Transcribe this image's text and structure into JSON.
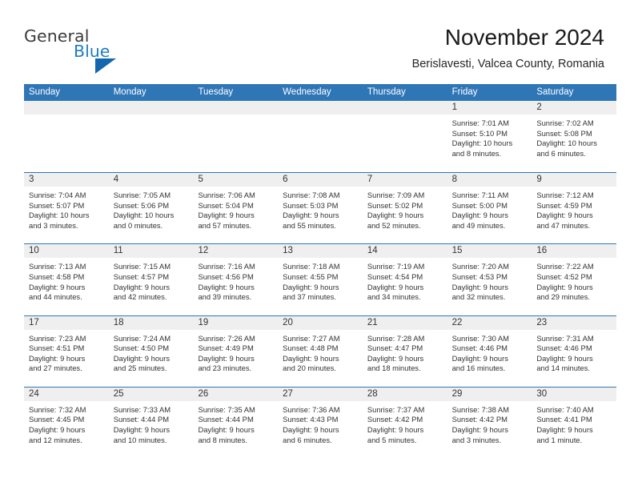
{
  "brand": {
    "name_part1": "General",
    "name_part2": "Blue",
    "triangle_icon": "triangle-logo-icon",
    "color_dark": "#3b3b3b",
    "color_blue": "#1d7dc4"
  },
  "header": {
    "title": "November 2024",
    "subtitle": "Berislavesti, Valcea County, Romania"
  },
  "theme": {
    "header_blue": "#2f76b7",
    "daynum_band": "#efefef",
    "text": "#333333"
  },
  "weekdays": [
    "Sunday",
    "Monday",
    "Tuesday",
    "Wednesday",
    "Thursday",
    "Friday",
    "Saturday"
  ],
  "weeks": [
    [
      {
        "day": "",
        "lines": []
      },
      {
        "day": "",
        "lines": []
      },
      {
        "day": "",
        "lines": []
      },
      {
        "day": "",
        "lines": []
      },
      {
        "day": "",
        "lines": []
      },
      {
        "day": "1",
        "lines": [
          "Sunrise: 7:01 AM",
          "Sunset: 5:10 PM",
          "Daylight: 10 hours",
          "and 8 minutes."
        ]
      },
      {
        "day": "2",
        "lines": [
          "Sunrise: 7:02 AM",
          "Sunset: 5:08 PM",
          "Daylight: 10 hours",
          "and 6 minutes."
        ]
      }
    ],
    [
      {
        "day": "3",
        "lines": [
          "Sunrise: 7:04 AM",
          "Sunset: 5:07 PM",
          "Daylight: 10 hours",
          "and 3 minutes."
        ]
      },
      {
        "day": "4",
        "lines": [
          "Sunrise: 7:05 AM",
          "Sunset: 5:06 PM",
          "Daylight: 10 hours",
          "and 0 minutes."
        ]
      },
      {
        "day": "5",
        "lines": [
          "Sunrise: 7:06 AM",
          "Sunset: 5:04 PM",
          "Daylight: 9 hours",
          "and 57 minutes."
        ]
      },
      {
        "day": "6",
        "lines": [
          "Sunrise: 7:08 AM",
          "Sunset: 5:03 PM",
          "Daylight: 9 hours",
          "and 55 minutes."
        ]
      },
      {
        "day": "7",
        "lines": [
          "Sunrise: 7:09 AM",
          "Sunset: 5:02 PM",
          "Daylight: 9 hours",
          "and 52 minutes."
        ]
      },
      {
        "day": "8",
        "lines": [
          "Sunrise: 7:11 AM",
          "Sunset: 5:00 PM",
          "Daylight: 9 hours",
          "and 49 minutes."
        ]
      },
      {
        "day": "9",
        "lines": [
          "Sunrise: 7:12 AM",
          "Sunset: 4:59 PM",
          "Daylight: 9 hours",
          "and 47 minutes."
        ]
      }
    ],
    [
      {
        "day": "10",
        "lines": [
          "Sunrise: 7:13 AM",
          "Sunset: 4:58 PM",
          "Daylight: 9 hours",
          "and 44 minutes."
        ]
      },
      {
        "day": "11",
        "lines": [
          "Sunrise: 7:15 AM",
          "Sunset: 4:57 PM",
          "Daylight: 9 hours",
          "and 42 minutes."
        ]
      },
      {
        "day": "12",
        "lines": [
          "Sunrise: 7:16 AM",
          "Sunset: 4:56 PM",
          "Daylight: 9 hours",
          "and 39 minutes."
        ]
      },
      {
        "day": "13",
        "lines": [
          "Sunrise: 7:18 AM",
          "Sunset: 4:55 PM",
          "Daylight: 9 hours",
          "and 37 minutes."
        ]
      },
      {
        "day": "14",
        "lines": [
          "Sunrise: 7:19 AM",
          "Sunset: 4:54 PM",
          "Daylight: 9 hours",
          "and 34 minutes."
        ]
      },
      {
        "day": "15",
        "lines": [
          "Sunrise: 7:20 AM",
          "Sunset: 4:53 PM",
          "Daylight: 9 hours",
          "and 32 minutes."
        ]
      },
      {
        "day": "16",
        "lines": [
          "Sunrise: 7:22 AM",
          "Sunset: 4:52 PM",
          "Daylight: 9 hours",
          "and 29 minutes."
        ]
      }
    ],
    [
      {
        "day": "17",
        "lines": [
          "Sunrise: 7:23 AM",
          "Sunset: 4:51 PM",
          "Daylight: 9 hours",
          "and 27 minutes."
        ]
      },
      {
        "day": "18",
        "lines": [
          "Sunrise: 7:24 AM",
          "Sunset: 4:50 PM",
          "Daylight: 9 hours",
          "and 25 minutes."
        ]
      },
      {
        "day": "19",
        "lines": [
          "Sunrise: 7:26 AM",
          "Sunset: 4:49 PM",
          "Daylight: 9 hours",
          "and 23 minutes."
        ]
      },
      {
        "day": "20",
        "lines": [
          "Sunrise: 7:27 AM",
          "Sunset: 4:48 PM",
          "Daylight: 9 hours",
          "and 20 minutes."
        ]
      },
      {
        "day": "21",
        "lines": [
          "Sunrise: 7:28 AM",
          "Sunset: 4:47 PM",
          "Daylight: 9 hours",
          "and 18 minutes."
        ]
      },
      {
        "day": "22",
        "lines": [
          "Sunrise: 7:30 AM",
          "Sunset: 4:46 PM",
          "Daylight: 9 hours",
          "and 16 minutes."
        ]
      },
      {
        "day": "23",
        "lines": [
          "Sunrise: 7:31 AM",
          "Sunset: 4:46 PM",
          "Daylight: 9 hours",
          "and 14 minutes."
        ]
      }
    ],
    [
      {
        "day": "24",
        "lines": [
          "Sunrise: 7:32 AM",
          "Sunset: 4:45 PM",
          "Daylight: 9 hours",
          "and 12 minutes."
        ]
      },
      {
        "day": "25",
        "lines": [
          "Sunrise: 7:33 AM",
          "Sunset: 4:44 PM",
          "Daylight: 9 hours",
          "and 10 minutes."
        ]
      },
      {
        "day": "26",
        "lines": [
          "Sunrise: 7:35 AM",
          "Sunset: 4:44 PM",
          "Daylight: 9 hours",
          "and 8 minutes."
        ]
      },
      {
        "day": "27",
        "lines": [
          "Sunrise: 7:36 AM",
          "Sunset: 4:43 PM",
          "Daylight: 9 hours",
          "and 6 minutes."
        ]
      },
      {
        "day": "28",
        "lines": [
          "Sunrise: 7:37 AM",
          "Sunset: 4:42 PM",
          "Daylight: 9 hours",
          "and 5 minutes."
        ]
      },
      {
        "day": "29",
        "lines": [
          "Sunrise: 7:38 AM",
          "Sunset: 4:42 PM",
          "Daylight: 9 hours",
          "and 3 minutes."
        ]
      },
      {
        "day": "30",
        "lines": [
          "Sunrise: 7:40 AM",
          "Sunset: 4:41 PM",
          "Daylight: 9 hours",
          "and 1 minute."
        ]
      }
    ]
  ]
}
